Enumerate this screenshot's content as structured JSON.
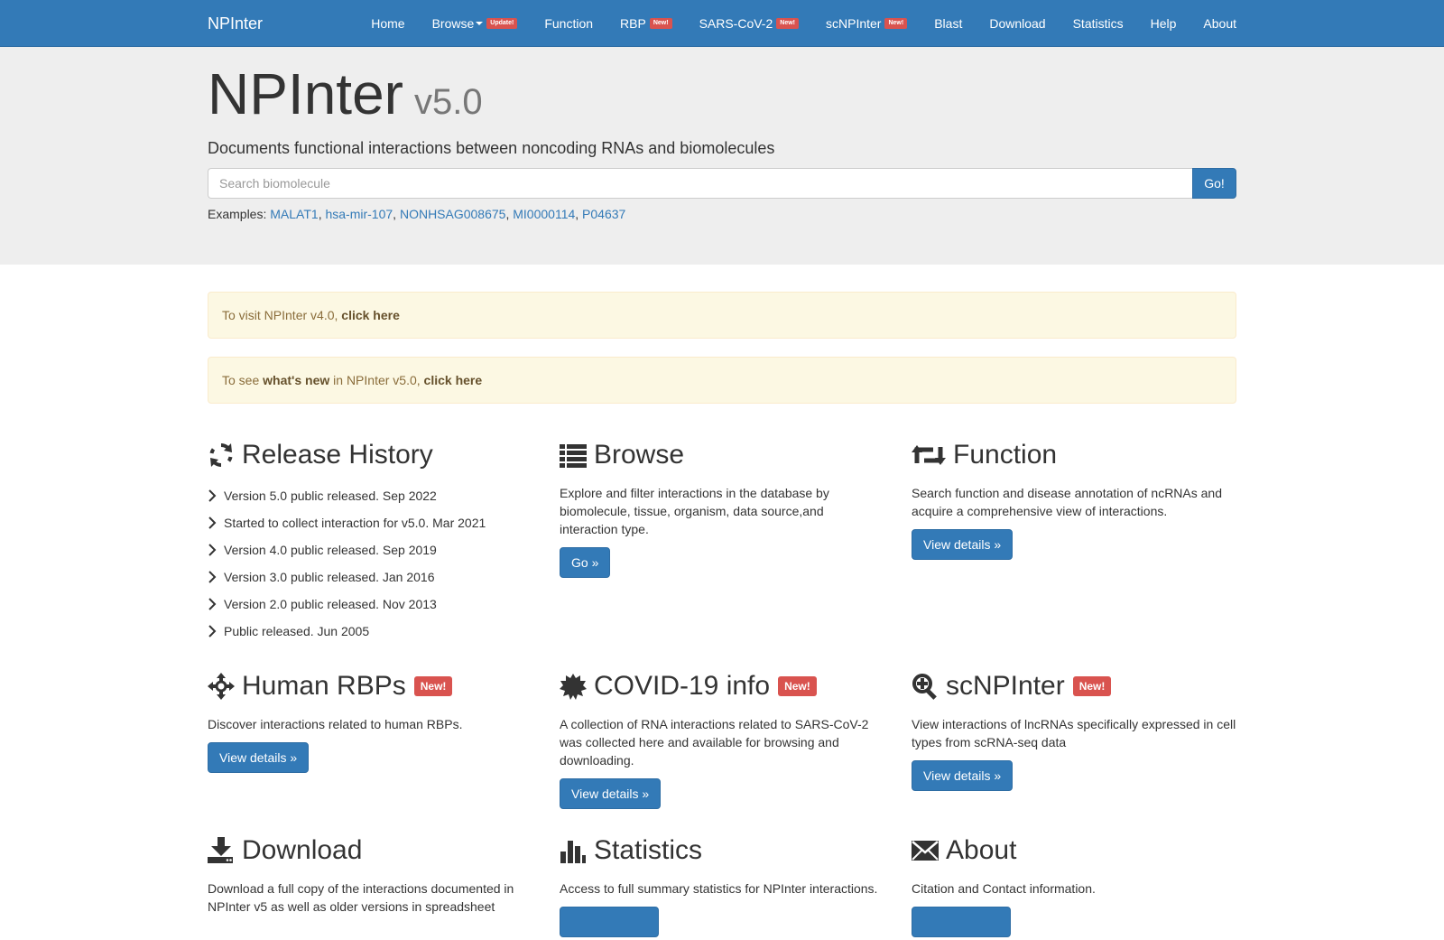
{
  "navbar": {
    "brand": "NPInter",
    "items": [
      {
        "label": "Home"
      },
      {
        "label": "Browse",
        "badge": "Update!",
        "caret": true
      },
      {
        "label": "Function"
      },
      {
        "label": "RBP",
        "badge": "New!"
      },
      {
        "label": "SARS-CoV-2",
        "badge": "New!"
      },
      {
        "label": "scNPInter",
        "badge": "New!"
      },
      {
        "label": "Blast"
      },
      {
        "label": "Download"
      },
      {
        "label": "Statistics"
      },
      {
        "label": "Help"
      },
      {
        "label": "About"
      }
    ]
  },
  "header": {
    "title": "NPInter",
    "version": "v5.0",
    "subtitle": "Documents functional interactions between noncoding RNAs and biomolecules"
  },
  "search": {
    "placeholder": "Search biomolecule",
    "value": "",
    "button": "Go!",
    "examples_label": "Examples:",
    "examples": [
      "MALAT1",
      "hsa-mir-107",
      "NONHSAG008675",
      "MI0000114",
      "P04637"
    ]
  },
  "alerts": {
    "v4": {
      "text": "To visit NPInter v4.0, ",
      "link": "click here"
    },
    "new": {
      "pre": "To see ",
      "bold": "what's new",
      "mid": " in NPInter v5.0, ",
      "link": "click here"
    }
  },
  "features": {
    "release": {
      "title": "Release History",
      "items": [
        "Version 5.0 public released. Sep 2022",
        "Started to collect interaction for v5.0. Mar 2021",
        "Version 4.0 public released. Sep 2019",
        "Version 3.0 public released. Jan 2016",
        "Version 2.0 public released. Nov 2013",
        "Public released. Jun 2005"
      ]
    },
    "browse": {
      "title": "Browse",
      "desc": "Explore and filter interactions in the database by biomolecule, tissue, organism, data source,and interaction type.",
      "button": "Go »"
    },
    "function": {
      "title": "Function",
      "desc": "Search function and disease annotation of ncRNAs and acquire a comprehensive view of interactions.",
      "button": "View details »"
    },
    "rbp": {
      "title": "Human RBPs",
      "badge": "New!",
      "desc": "Discover interactions related to human RBPs.",
      "button": "View details »"
    },
    "covid": {
      "title": "COVID-19 info",
      "badge": "New!",
      "desc": "A collection of RNA interactions related to SARS-CoV-2 was collected here and available for browsing and downloading.",
      "button": "View details »"
    },
    "sc": {
      "title": "scNPInter",
      "badge": "New!",
      "desc": "View interactions of lncRNAs specifically expressed in cell types from scRNA-seq data",
      "button": "View details »"
    },
    "download": {
      "title": "Download",
      "desc": "Download a full copy of the interactions documented in NPInter v5 as well as older versions in spreadsheet"
    },
    "statistics": {
      "title": "Statistics",
      "desc": "Access to full summary statistics for NPInter interactions."
    },
    "about": {
      "title": "About",
      "desc": "Citation and Contact information."
    }
  },
  "icons": {
    "release": "refresh-icon",
    "browse": "list-icon",
    "function": "retweet-icon",
    "rbp": "move-icon",
    "covid": "certificate-icon",
    "sc": "zoom-in-icon",
    "download": "download-icon",
    "statistics": "stats-icon",
    "about": "envelope-icon"
  },
  "colors": {
    "primary": "#337ab7",
    "danger": "#d9534f",
    "jumbotron": "#eeeeee",
    "alert_bg": "#fcf8e3"
  }
}
